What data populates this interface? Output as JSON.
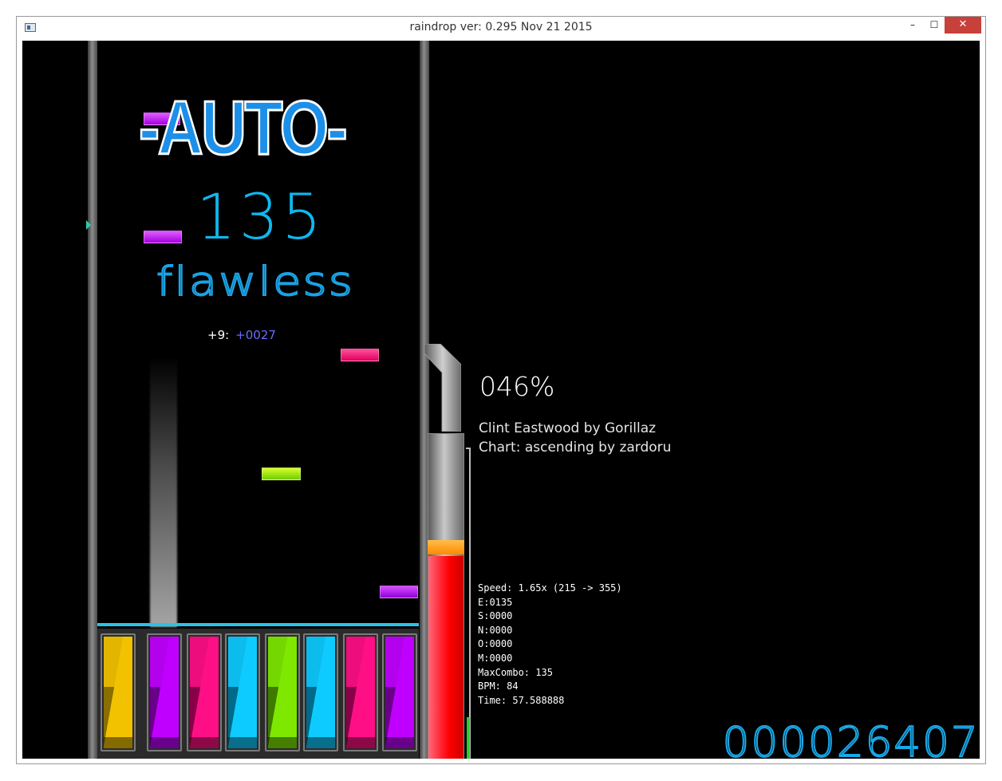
{
  "window": {
    "title": "raindrop ver: 0.295 Nov 21 2015",
    "minimize_label": "–",
    "maximize_label": "☐",
    "close_label": "✕"
  },
  "hud": {
    "mode": "-AUTO-",
    "combo": "135",
    "judgement": "flawless",
    "offset_label": "+9:",
    "offset_value": "+0027",
    "progress": "046%",
    "song": "Clint Eastwood by Gorillaz",
    "chart": "Chart: ascending by zardoru",
    "score": "000026407"
  },
  "stats": {
    "speed": "Speed: 1.65x (215 -> 355)",
    "e": "E:0135",
    "s": "S:0000",
    "n": "N:0000",
    "o": "O:0000",
    "m": "M:0000",
    "max_combo": "MaxCombo: 135",
    "bpm": "BPM: 84",
    "time": "Time: 57.588888"
  },
  "keys": [
    {
      "color": "#f2c200",
      "dark": "#8a6e00"
    },
    {
      "color": "#c000ff",
      "dark": "#6a008a"
    },
    {
      "color": "#ff0f86",
      "dark": "#8a0048"
    },
    {
      "color": "#0ecbff",
      "dark": "#006a8a"
    },
    {
      "color": "#7ee800",
      "dark": "#3f7a00"
    },
    {
      "color": "#0ecbff",
      "dark": "#006a8a"
    },
    {
      "color": "#ff0f86",
      "dark": "#8a0048"
    },
    {
      "color": "#c000ff",
      "dark": "#6a008a"
    }
  ],
  "colors": {
    "accent": "#19a8e8",
    "health": "#ff0000",
    "background": "#000000"
  }
}
